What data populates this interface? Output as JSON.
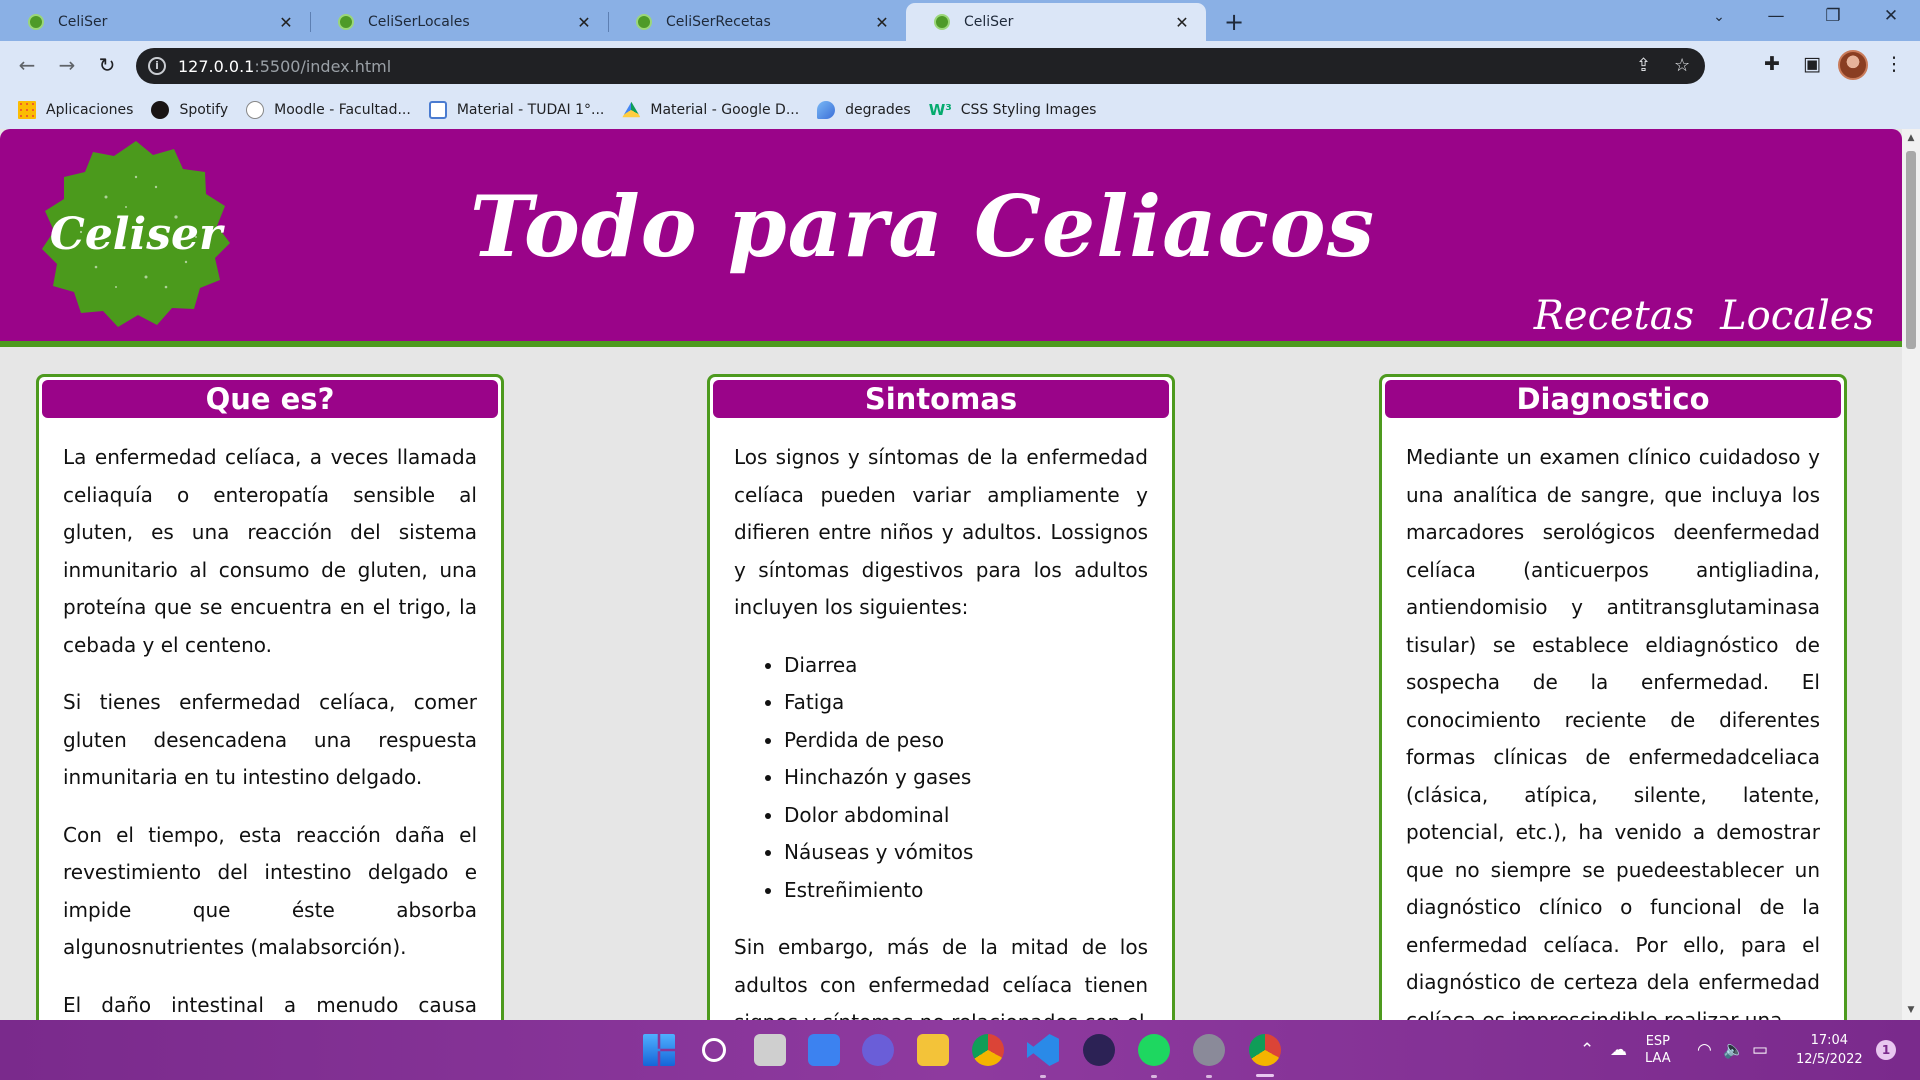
{
  "browser": {
    "tabs": [
      {
        "title": "CeliSer",
        "active": false
      },
      {
        "title": "CeliSerLocales",
        "active": false
      },
      {
        "title": "CeliSerRecetas",
        "active": false
      },
      {
        "title": "CeliSer",
        "active": true
      }
    ],
    "new_tab": "+",
    "url_host": "127.0.0.1",
    "url_path": ":5500/index.html",
    "bookmarks": [
      {
        "label": "Aplicaciones",
        "icon": "apps-grid-icon"
      },
      {
        "label": "Spotify",
        "icon": "spotify-icon"
      },
      {
        "label": "Moodle - Facultad...",
        "icon": "moodle-icon"
      },
      {
        "label": "Material - TUDAI 1°...",
        "icon": "tudai-icon"
      },
      {
        "label": "Material - Google D...",
        "icon": "google-drive-icon"
      },
      {
        "label": "degrades",
        "icon": "degrades-icon"
      },
      {
        "label": "CSS Styling Images",
        "icon": "w3schools-icon"
      }
    ]
  },
  "site": {
    "logo_text": "Celiser",
    "title": "Todo para Celiacos",
    "nav": [
      "Recetas",
      "Locales"
    ],
    "colors": {
      "primary": "#9a0489",
      "accent": "#4d9a1e",
      "background": "#e6e6e6"
    },
    "cards": [
      {
        "title": "Que es?",
        "paragraphs": [
          "La enfermedad celíaca, a veces llamada celiaquía o enteropatía sensible al gluten, es una reacción del sistema inmunitario al consumo de gluten, una proteína que se encuentra en el trigo, la cebada y el centeno.",
          "Si tienes enfermedad celíaca, comer gluten desencadena una respuesta inmunitaria en tu intestino delgado.",
          "Con el tiempo, esta reacción daña el revestimiento del intestino delgado e impide que éste absorba algunosnutrientes (malabsorción).",
          "El daño intestinal a menudo causa diarrea,"
        ]
      },
      {
        "title": "Sintomas",
        "intro": "Los signos y síntomas de la enfermedad celíaca pueden variar ampliamente y difieren entre niños y adultos. Lossignos y síntomas digestivos para los adultos incluyen los siguientes:",
        "list": [
          "Diarrea",
          "Fatiga",
          "Perdida de peso",
          "Hinchazón y gases",
          "Dolor abdominal",
          "Náuseas y vómitos",
          "Estreñimiento"
        ],
        "outro": "Sin embargo, más de la mitad de los adultos con enfermedad celíaca tienen signos y síntomas no relacionados con el"
      },
      {
        "title": "Diagnostico",
        "paragraphs": [
          "Mediante un examen clínico cuidadoso y una analítica de sangre, que incluya los marcadores serológicos deenfermedad celíaca (anticuerpos antigliadina, antiendomisio y antitransglutaminasa tisular) se establece eldiagnóstico de sospecha de la enfermedad. El conocimiento reciente de diferentes formas clínicas de enfermedadceliaca (clásica, atípica, silente, latente, potencial, etc.), ha venido a demostrar que no siempre se puedeestablecer un diagnóstico clínico o funcional de la enfermedad celíaca. Por ello, para el diagnóstico de certeza dela enfermedad celíaca es imprescindible realizar una"
        ]
      }
    ]
  },
  "taskbar": {
    "lang_top": "ESP",
    "lang_bottom": "LAA",
    "time": "17:04",
    "date": "12/5/2022",
    "notifications": "1"
  }
}
